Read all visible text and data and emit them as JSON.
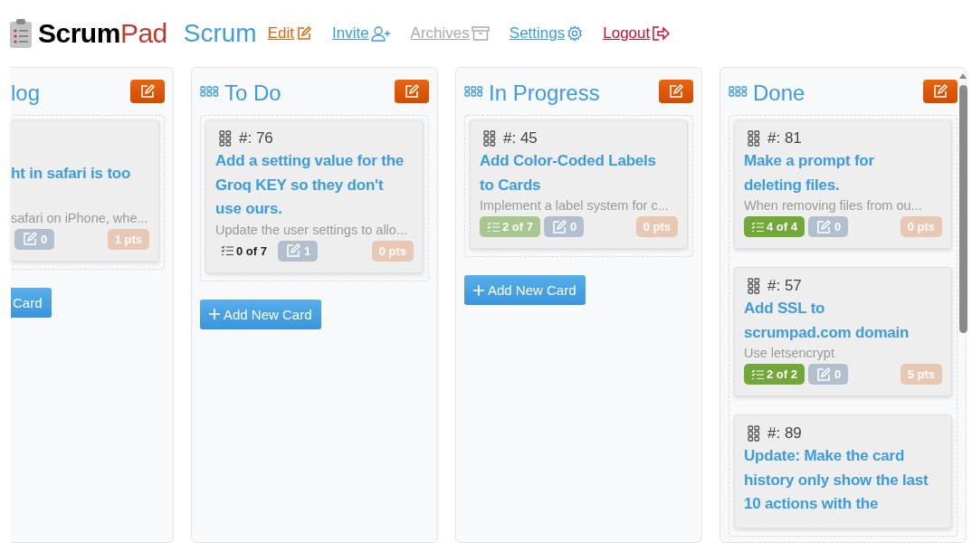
{
  "header": {
    "logo_first": "Scrum",
    "logo_second": "Pad",
    "board_title": "Scrum",
    "nav": [
      {
        "label": "Edit",
        "kind": "edit",
        "color": "#e0650f"
      },
      {
        "label": "Invite",
        "kind": "invite",
        "color": "#3d9be0"
      },
      {
        "label": "Archives",
        "kind": "archive",
        "color": "#a9a9a9"
      },
      {
        "label": "Settings",
        "kind": "settings",
        "color": "#3d9be0"
      },
      {
        "label": "Logout",
        "kind": "logout",
        "color": "#c8102e"
      }
    ]
  },
  "columns": [
    {
      "title": "log",
      "cut": true,
      "add_button": "Card",
      "cards": [
        {
          "title": "ht in safari is too",
          "description": "safari on iPhone, whe...",
          "comments": "0",
          "points": "1 pts"
        }
      ]
    },
    {
      "title": "To Do",
      "cut": false,
      "add_button": "Add New Card",
      "cards": [
        {
          "id": "#: 76",
          "title": "Add a setting value for the Groq KEY so they don't use ours.",
          "description": "Update the user settings to allo...",
          "checklist": {
            "kind": "none",
            "text": "0 of 7"
          },
          "comments": "1",
          "points": "0 pts"
        }
      ]
    },
    {
      "title": "In Progress",
      "cut": false,
      "add_button": "Add New Card",
      "cards": [
        {
          "id": "#: 45",
          "title": "Add Color-Coded Labels to Cards",
          "description": "Implement a label system for c...",
          "checklist": {
            "kind": "partial",
            "text": "2 of 7"
          },
          "comments": "0",
          "points": "0 pts"
        }
      ]
    },
    {
      "title": "Done",
      "cut": false,
      "cards": [
        {
          "id": "#: 81",
          "title": "Make a prompt for deleting files.",
          "description": "When removing files from ou...",
          "checklist": {
            "kind": "done",
            "text": "4 of 4"
          },
          "comments": "0",
          "points": "0 pts"
        },
        {
          "id": "#: 57",
          "title": "Add SSL to scrumpad.com domain",
          "description": "Use letsencrypt",
          "checklist": {
            "kind": "done",
            "text": "2 of 2"
          },
          "comments": "0",
          "points": "5 pts"
        },
        {
          "id": "#: 89",
          "title": "Update: Make the card history only show the last 10 actions with the"
        }
      ]
    }
  ]
}
